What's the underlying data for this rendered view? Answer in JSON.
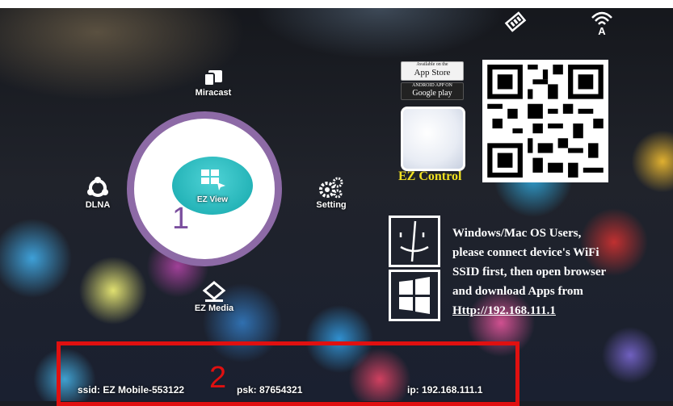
{
  "menu": {
    "miracast": "Miracast",
    "dlna": "DLNA",
    "ez_view": "EZ View",
    "setting": "Setting",
    "ez_media": "EZ Media"
  },
  "apps": {
    "app_store_small": "Available on the",
    "app_store": "App Store",
    "google_play_small": "ANDROID APP ON",
    "google_play": "Google play",
    "ez_control": "EZ Control"
  },
  "instructions": {
    "line1": "Windows/Mac OS Users,",
    "line2": "please connect device's WiFi",
    "line3": "SSID first, then open browser",
    "line4": "and download Apps from",
    "link": "Http://192.168.111.1"
  },
  "annotations": {
    "marker1": "1",
    "marker2": "2",
    "marker1_color": "#7b4f9e",
    "marker2_color": "#e01010"
  },
  "status": {
    "ssid": "ssid: EZ Mobile-553122",
    "psk": "psk: 87654321",
    "ip": "ip: 192.168.111.1"
  },
  "icons": [
    "ethernet-icon",
    "wifi-icon",
    "miracast-icon",
    "dlna-icon",
    "ez-view-icon",
    "setting-icon",
    "ez-media-icon",
    "finder-icon",
    "windows-icon",
    "qr-code"
  ]
}
